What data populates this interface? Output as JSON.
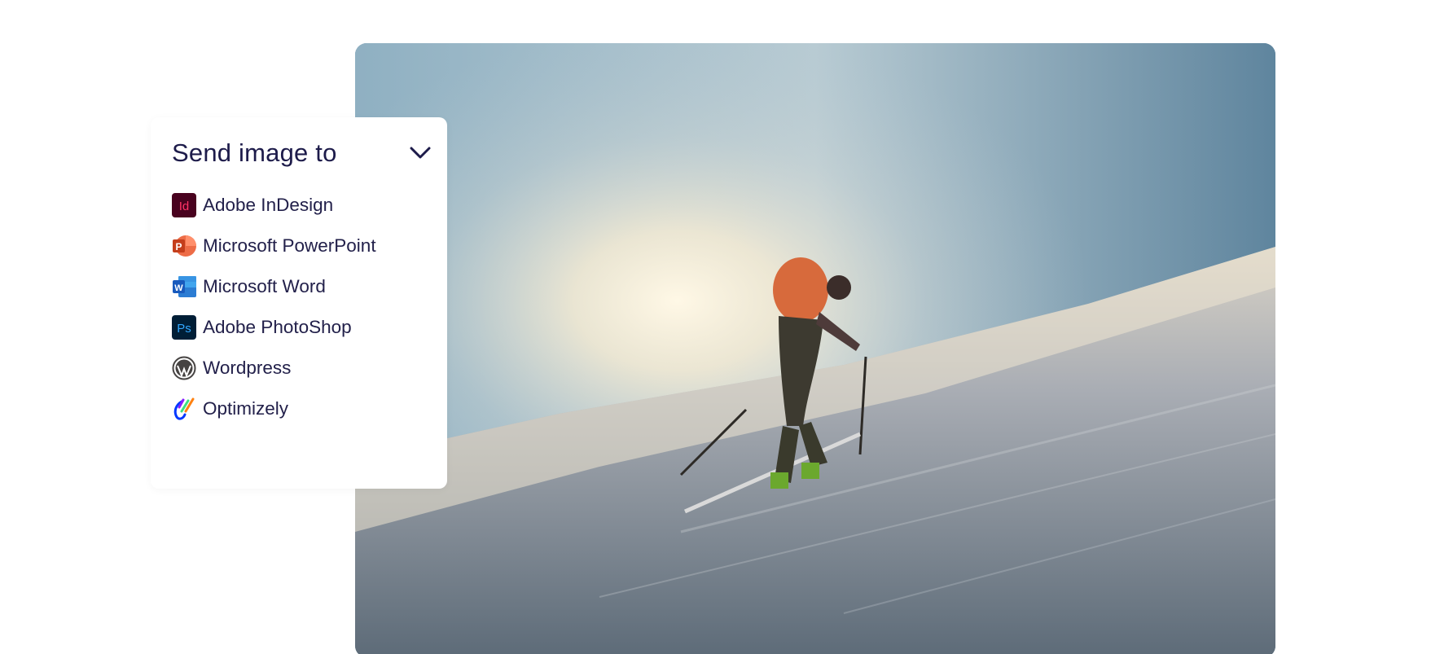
{
  "panel": {
    "title": "Send image to",
    "toggle_icon": "chevron-down-icon",
    "items": [
      {
        "label": "Adobe InDesign",
        "icon": "adobe-indesign-icon",
        "color": "#49021f"
      },
      {
        "label": "Microsoft PowerPoint",
        "icon": "microsoft-powerpoint-icon",
        "color": "#d35230"
      },
      {
        "label": "Microsoft Word",
        "icon": "microsoft-word-icon",
        "color": "#185abd"
      },
      {
        "label": "Adobe PhotoShop",
        "icon": "adobe-photoshop-icon",
        "color": "#001e36"
      },
      {
        "label": "Wordpress",
        "icon": "wordpress-icon",
        "color": "#464342"
      },
      {
        "label": "Optimizely",
        "icon": "optimizely-icon",
        "color": "#0037ff"
      }
    ]
  },
  "photo": {
    "subject": "skier-on-snowy-slope-image"
  },
  "colors": {
    "title_text": "#1d1b4a",
    "item_text": "#22204a",
    "card_bg": "#ffffff"
  }
}
